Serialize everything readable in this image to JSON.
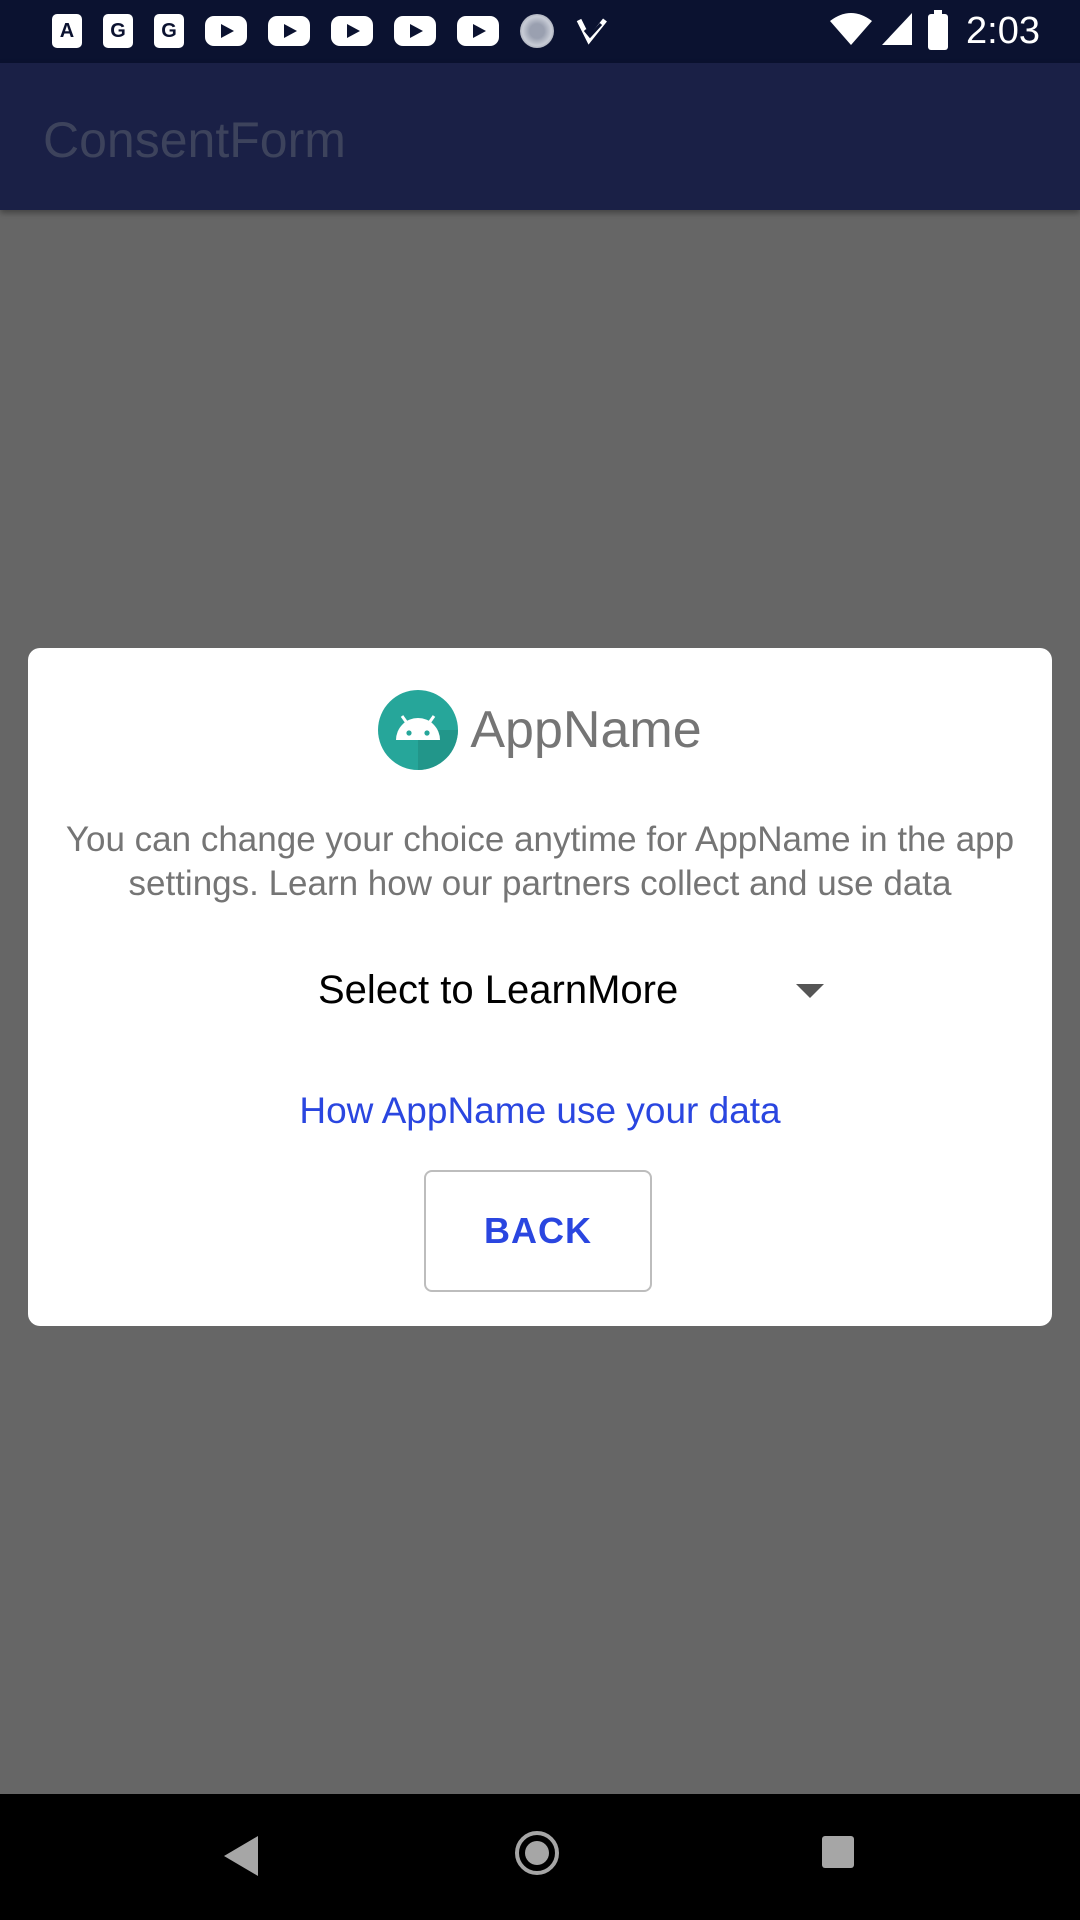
{
  "status_bar": {
    "time": "2:03",
    "notification_icons": [
      {
        "name": "translate-a-icon",
        "glyph": "A",
        "kind": "square"
      },
      {
        "name": "maps-g-icon",
        "glyph": "G",
        "kind": "square"
      },
      {
        "name": "maps-g-icon",
        "glyph": "G",
        "kind": "square"
      },
      {
        "name": "youtube-icon",
        "kind": "yt"
      },
      {
        "name": "youtube-icon",
        "kind": "yt"
      },
      {
        "name": "youtube-icon",
        "kind": "yt"
      },
      {
        "name": "youtube-icon",
        "kind": "yt"
      },
      {
        "name": "youtube-icon",
        "kind": "yt"
      },
      {
        "name": "sync-icon",
        "kind": "sync"
      },
      {
        "name": "task-check-icon",
        "kind": "check"
      }
    ],
    "system_icons": [
      "wifi-icon",
      "signal-icon",
      "battery-charging-icon"
    ]
  },
  "app_bar": {
    "title": "ConsentForm"
  },
  "dialog": {
    "app_name": "AppName",
    "app_icon": "android-icon",
    "message": "You can change your choice anytime for AppName in the app settings. Learn how our partners collect and use data",
    "spinner_value": "Select to LearnMore",
    "link_text": "How AppName use your data",
    "back_label": "BACK"
  },
  "nav_bar": {
    "buttons": [
      "back-nav-icon",
      "home-nav-icon",
      "recents-nav-icon"
    ]
  },
  "colors": {
    "status_bar_bg": "#0b1230",
    "app_bar_bg": "#1a2046",
    "scrim": "#666666",
    "accent": "#2a46e0",
    "icon_teal": "#26a69a"
  }
}
